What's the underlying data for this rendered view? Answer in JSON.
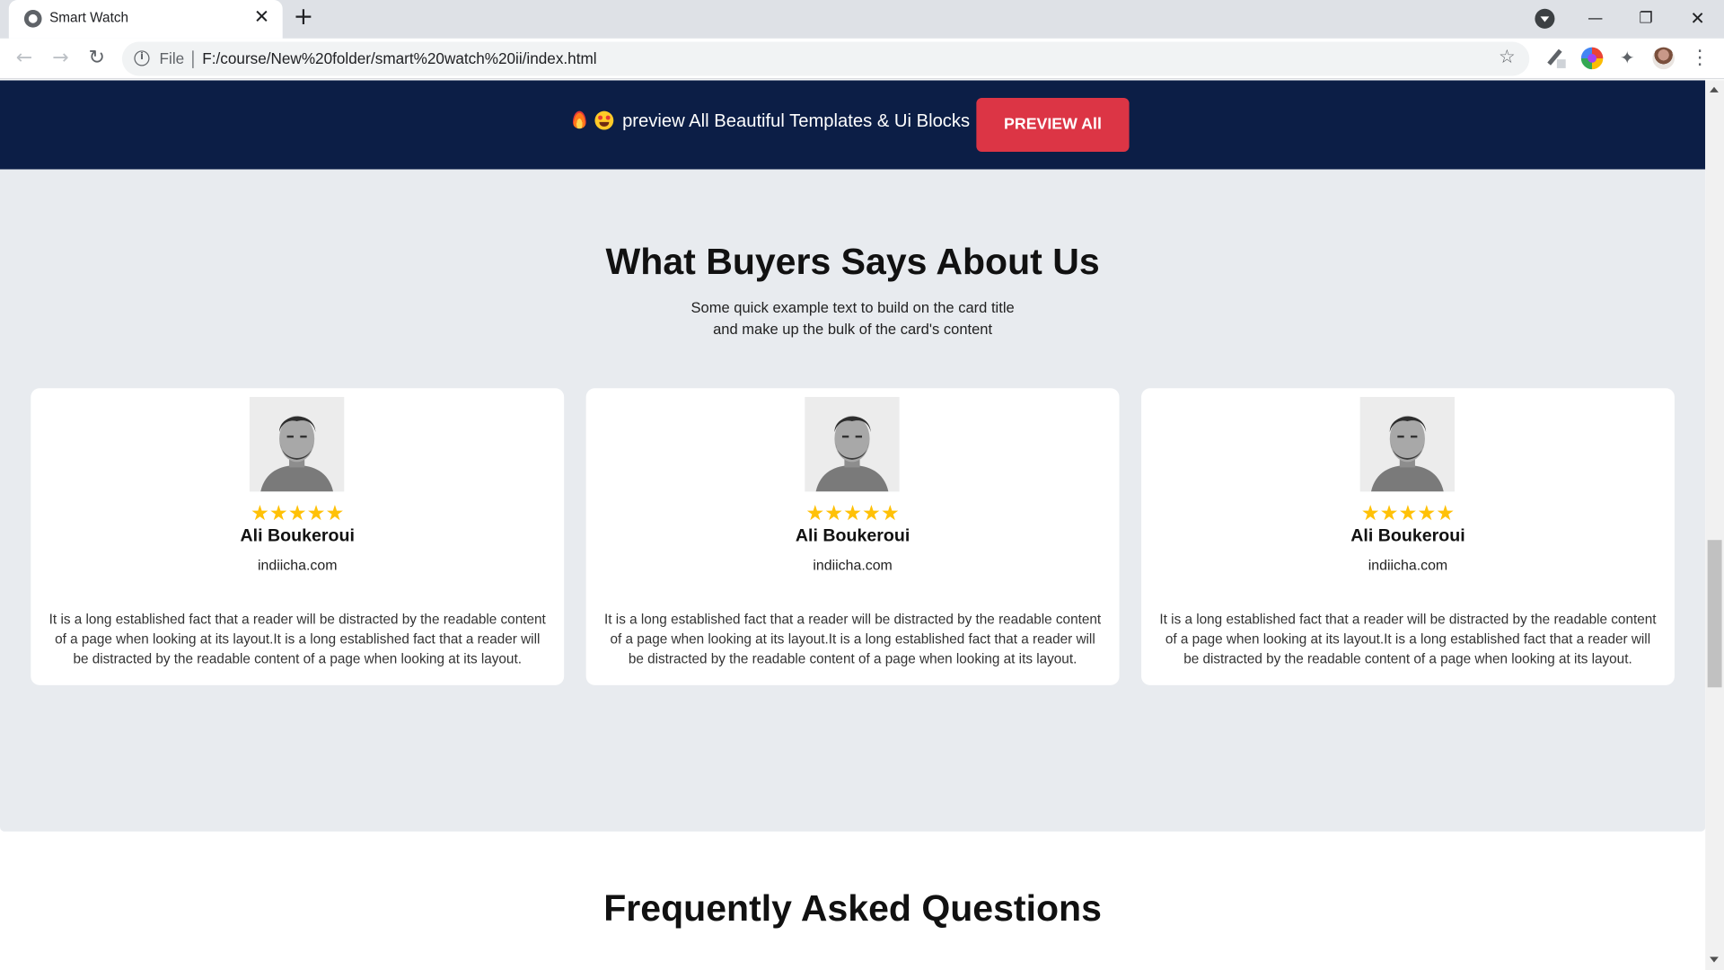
{
  "browser": {
    "tab_title": "Smart Watch",
    "tab_close": "✕",
    "new_tab": "+",
    "scheme": "File",
    "url": "F:/course/New%20folder/smart%20watch%20ii/index.html",
    "back": "←",
    "forward": "→",
    "reload": "↻",
    "star": "☆",
    "minimize": "—",
    "maximize": "❐",
    "close": "✕",
    "menu": "⋮",
    "info": "i",
    "puzzle": "✦"
  },
  "banner": {
    "text": "preview All Beautiful Templates & Ui Blocks",
    "button": "PREVIEW All"
  },
  "testimonials": {
    "title": "What Buyers Says About Us",
    "subtitle_line1": "Some quick example text to build on the card title",
    "subtitle_line2": "and make up the bulk of the card's content",
    "cards": [
      {
        "stars": 5,
        "name": "Ali Boukeroui",
        "site": "indiicha.com",
        "quote": "It is a long established fact that a reader will be distracted by the readable content of a page when looking at its layout.It is a long established fact that a reader will be distracted by the readable content of a page when looking at its layout."
      },
      {
        "stars": 5,
        "name": "Ali Boukeroui",
        "site": "indiicha.com",
        "quote": "It is a long established fact that a reader will be distracted by the readable content of a page when looking at its layout.It is a long established fact that a reader will be distracted by the readable content of a page when looking at its layout."
      },
      {
        "stars": 5,
        "name": "Ali Boukeroui",
        "site": "indiicha.com",
        "quote": "It is a long established fact that a reader will be distracted by the readable content of a page when looking at its layout.It is a long established fact that a reader will be distracted by the readable content of a page when looking at its layout."
      }
    ]
  },
  "faq": {
    "title": "Frequently Asked Questions"
  },
  "colors": {
    "banner_bg": "#0c1e46",
    "button_red": "#dc3545",
    "section_bg": "#e8ebef",
    "star_gold": "#ffc107"
  },
  "icons": {
    "banner_left": [
      "fire-icon",
      "star-struck-emoji-icon"
    ],
    "rating": "star-icon"
  }
}
